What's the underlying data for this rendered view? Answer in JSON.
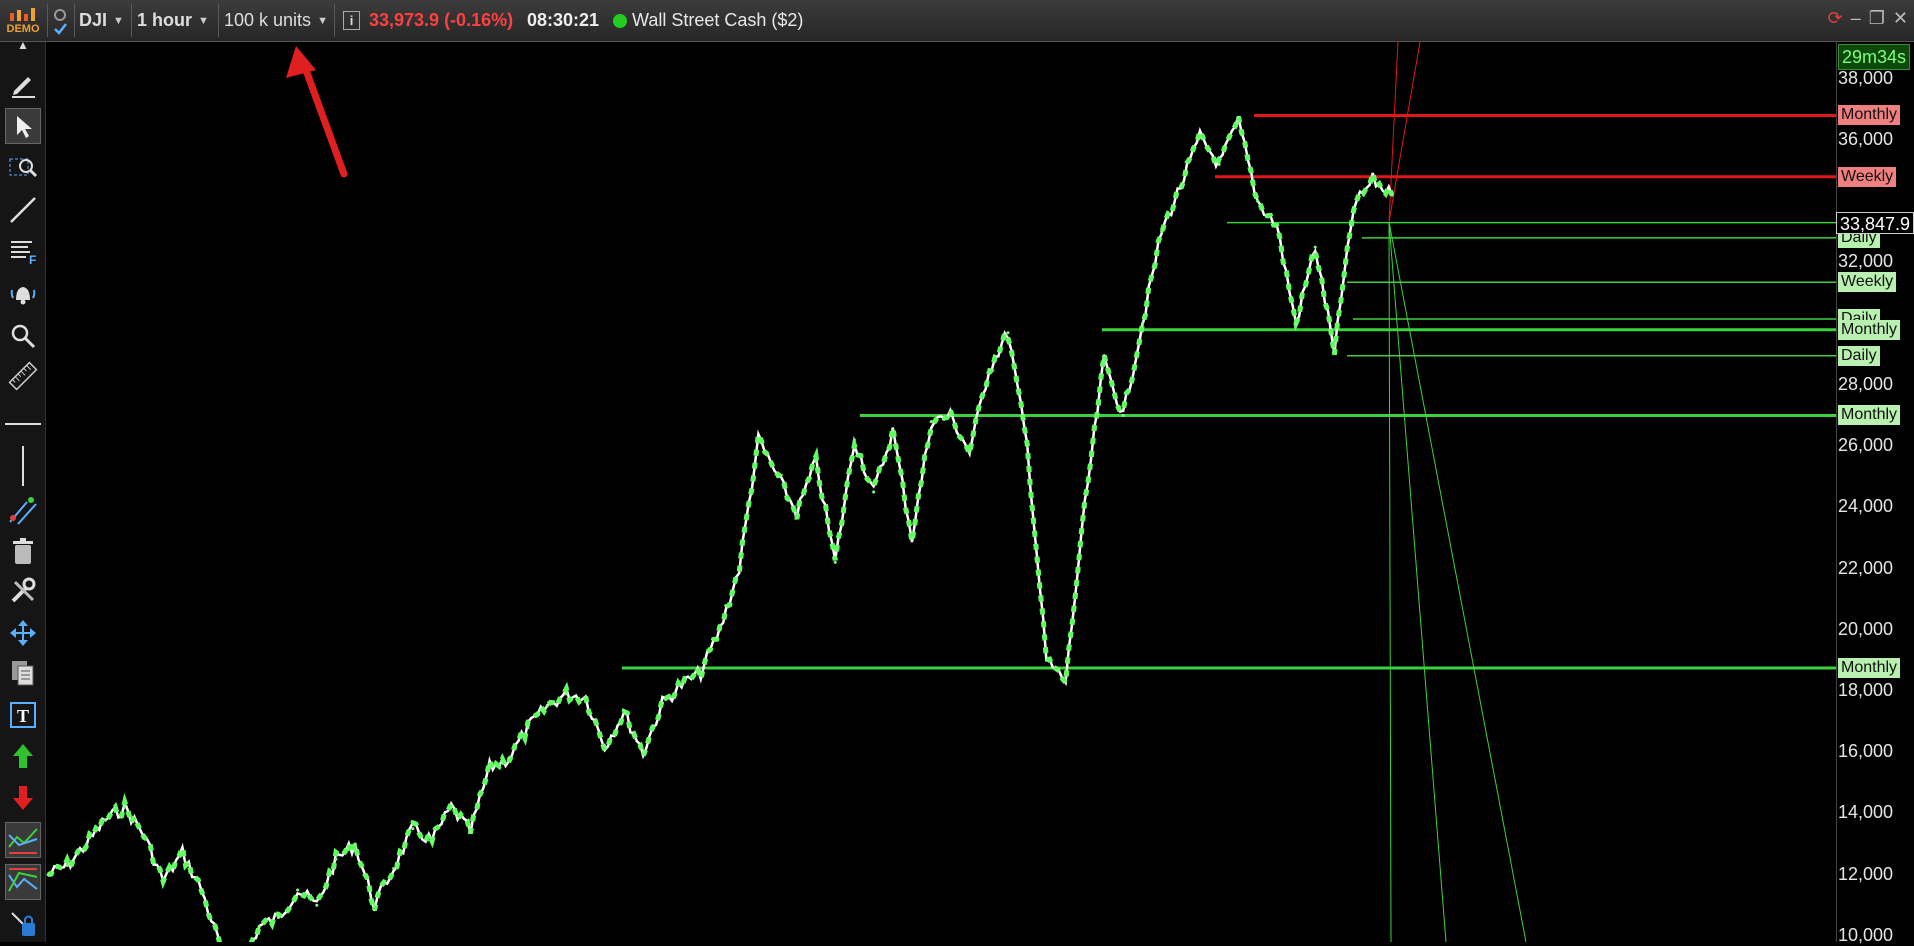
{
  "toolbar": {
    "demo_badge": "DEMO",
    "symbol": "DJI",
    "timeframe": "1 hour",
    "units": "100 k units",
    "price_change": "33,973.9 (-0.16%)",
    "time": "08:30:21",
    "instrument": "Wall Street Cash ($2)",
    "info_icon": "info-icon",
    "status_color": "#22cc22"
  },
  "sidebar": {
    "tools": [
      {
        "name": "pencil-icon"
      },
      {
        "name": "cursor-icon"
      },
      {
        "name": "zoom-box-icon"
      },
      {
        "name": "trendline-icon"
      },
      {
        "name": "fibonacci-icon"
      },
      {
        "name": "alert-bell-icon"
      },
      {
        "name": "magnifier-icon"
      },
      {
        "name": "ruler-icon"
      },
      {
        "name": "horizontal-line-icon"
      },
      {
        "name": "vertical-line-icon"
      },
      {
        "name": "parallel-channel-icon"
      },
      {
        "name": "trash-icon"
      },
      {
        "name": "tools-icon"
      },
      {
        "name": "move-icon"
      },
      {
        "name": "copy-icon"
      },
      {
        "name": "text-icon"
      },
      {
        "name": "buy-arrow-icon"
      },
      {
        "name": "sell-arrow-icon"
      },
      {
        "name": "indicator-icon"
      },
      {
        "name": "indicator-2-icon"
      },
      {
        "name": "lock-icon"
      }
    ]
  },
  "axis": {
    "timer": "29m34s",
    "current_price_tag": "33,847.9",
    "ticks": [
      "38,000",
      "36,000",
      "32,000",
      "28,000",
      "26,000",
      "24,000",
      "22,000",
      "20,000",
      "18,000",
      "16,000",
      "14,000",
      "12,000",
      "10,000"
    ]
  },
  "levels": [
    {
      "label": "Monthly",
      "price": 36800,
      "color": "red"
    },
    {
      "label": "Weekly",
      "price": 34800,
      "color": "red"
    },
    {
      "label": "Weekly",
      "price": 33300,
      "color": "green"
    },
    {
      "label": "Daily",
      "price": 32800,
      "color": "green"
    },
    {
      "label": "Weekly",
      "price": 31350,
      "color": "green"
    },
    {
      "label": "Daily",
      "price": 30150,
      "color": "green"
    },
    {
      "label": "Monthly",
      "price": 29800,
      "color": "green"
    },
    {
      "label": "Daily",
      "price": 28950,
      "color": "green"
    },
    {
      "label": "Monthly",
      "price": 27000,
      "color": "green"
    },
    {
      "label": "Monthly",
      "price": 18750,
      "color": "green"
    }
  ],
  "colors": {
    "resistance": "#e01818",
    "support": "#3cd23c",
    "candle_up": "#5cff5c",
    "candle_down": "#e060e0"
  },
  "chart_data": {
    "type": "line",
    "title": "",
    "xlabel": "",
    "ylabel": "",
    "ylim": [
      9800,
      39200
    ],
    "series": [
      {
        "values": [
          12000,
          12300,
          13000,
          13800,
          14200,
          13300,
          11800,
          12700,
          11500,
          9600,
          9000,
          10300,
          10600,
          11500,
          11000,
          12500,
          13000,
          11000,
          12200,
          13500,
          13100,
          14200,
          13400,
          15500,
          15800,
          16800,
          17500,
          17900,
          17800,
          16200,
          17300,
          16000,
          17600,
          18200,
          18600,
          20000,
          22000,
          26200,
          25000,
          23800,
          25500,
          22200,
          26200,
          24500,
          26500,
          23000,
          26800,
          27000,
          25800,
          28500,
          29700,
          26000,
          19000,
          18300,
          24000,
          28800,
          27000,
          30000,
          33000,
          34500,
          36100,
          35200,
          36600,
          34000,
          33200,
          30000,
          32500,
          29100,
          33800,
          34700,
          34200
        ]
      }
    ]
  },
  "annotation": {
    "arrow_color": "#e02020"
  }
}
